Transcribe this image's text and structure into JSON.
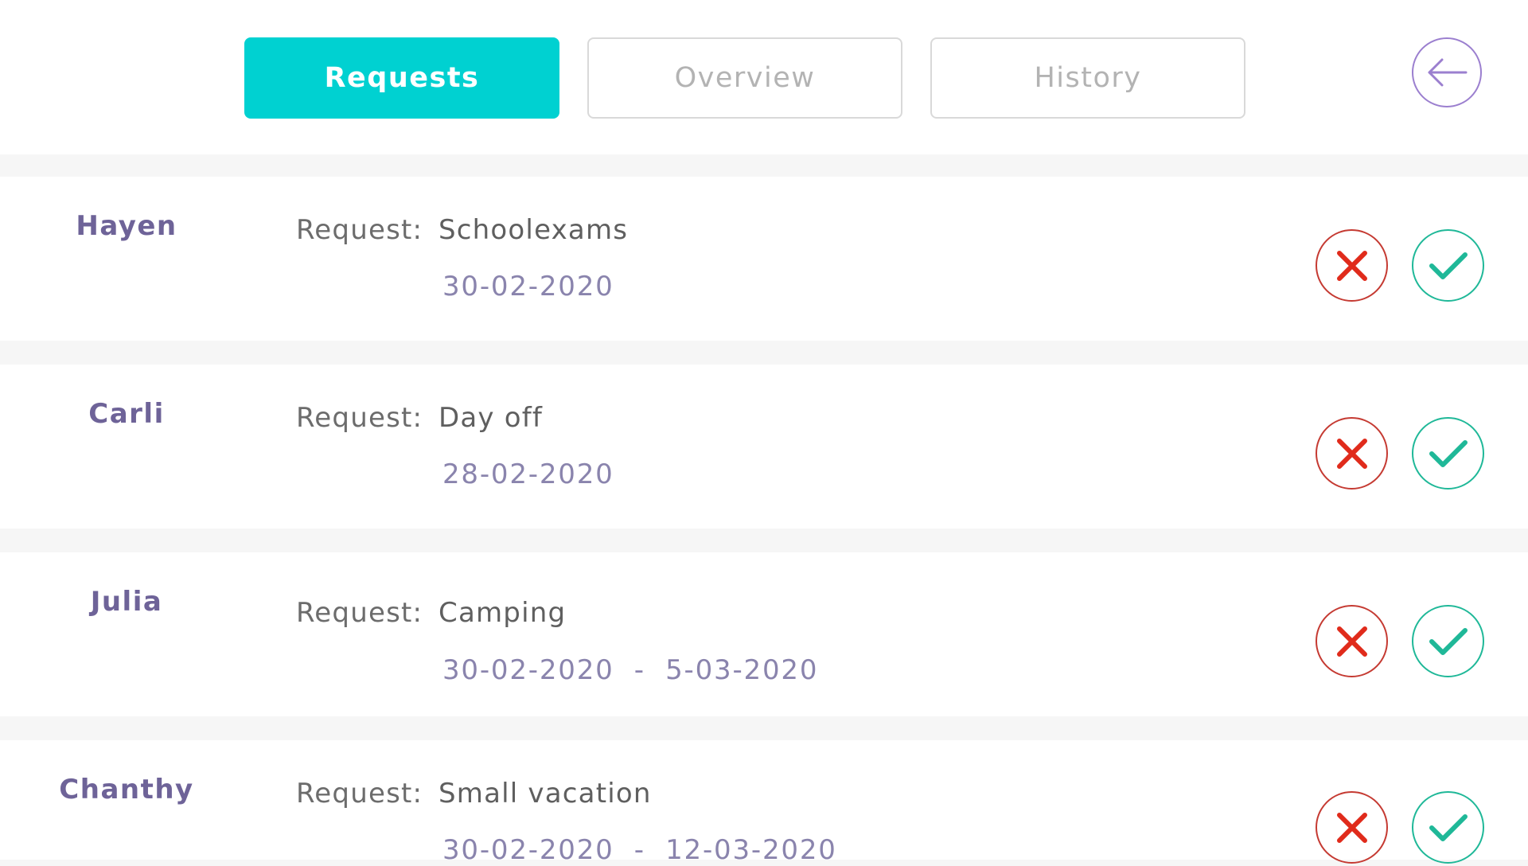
{
  "tabs": [
    {
      "label": "Requests",
      "active": true
    },
    {
      "label": "Overview",
      "active": false
    },
    {
      "label": "History",
      "active": false
    }
  ],
  "request_prefix": "Request:",
  "requests": [
    {
      "name": "Hayen",
      "title": "Schoolexams",
      "dates": "30-02-2020"
    },
    {
      "name": "Carli",
      "title": "Day off",
      "dates": "28-02-2020"
    },
    {
      "name": "Julia",
      "title": "Camping",
      "dates": "30-02-2020  -  5-03-2020"
    },
    {
      "name": "Chanthy",
      "title": "Small vacation",
      "dates": "30-02-2020  -  12-03-2020"
    }
  ],
  "icons": {
    "back": "arrow-left-icon",
    "reject": "close-icon",
    "approve": "check-icon"
  },
  "colors": {
    "accent": "#00d1d1",
    "back": "#9b7fcf",
    "reject": "#e02b1b",
    "approve": "#1fb898",
    "name": "#6e6398",
    "date": "#8a84ad"
  }
}
